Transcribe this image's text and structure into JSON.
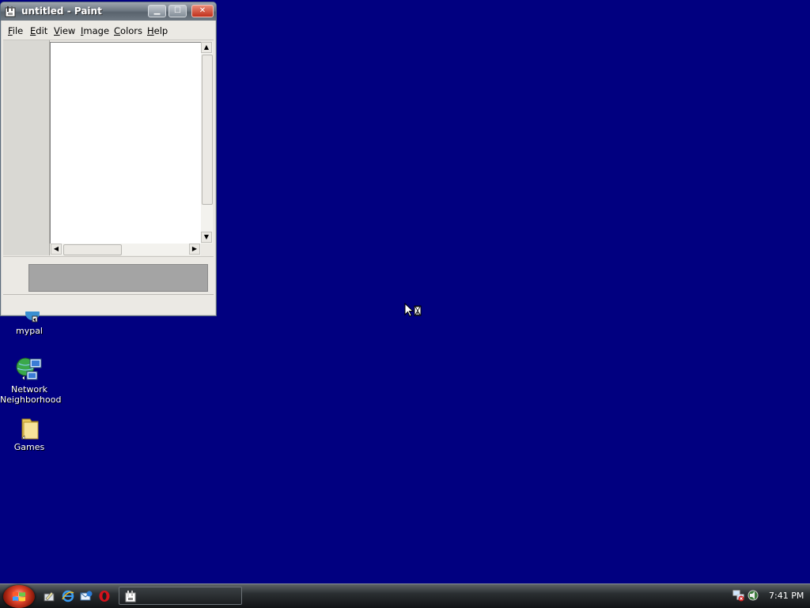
{
  "window": {
    "title": "untitled - Paint",
    "minimize_glyph": "▁",
    "maximize_glyph": "☐",
    "close_glyph": "✕"
  },
  "menu": [
    {
      "underline": "F",
      "rest": "ile"
    },
    {
      "underline": "E",
      "rest": "dit"
    },
    {
      "underline": "V",
      "rest": "iew"
    },
    {
      "underline": "I",
      "rest": "mage"
    },
    {
      "underline": "C",
      "rest": "olors"
    },
    {
      "underline": "H",
      "rest": "elp"
    }
  ],
  "desktop_icons": [
    {
      "label": "mypal",
      "icon": "mypal-icon"
    },
    {
      "label_line1": "Network",
      "label_line2": "Neighborhood",
      "icon": "network-neighborhood-icon"
    },
    {
      "label": "Games",
      "icon": "folder-icon"
    }
  ],
  "taskbar": {
    "clock": "7:41 PM",
    "quick_launch": [
      "show-desktop-icon",
      "internet-explorer-icon",
      "outlook-express-icon",
      "opera-icon"
    ],
    "task_button_icon": "paint-icon",
    "tray": [
      "network-tray-icon",
      "volume-tray-icon"
    ]
  },
  "colors": {
    "desktop": "#010080",
    "taskbar": "#1a1d20",
    "start_orb": "#e0452c"
  }
}
